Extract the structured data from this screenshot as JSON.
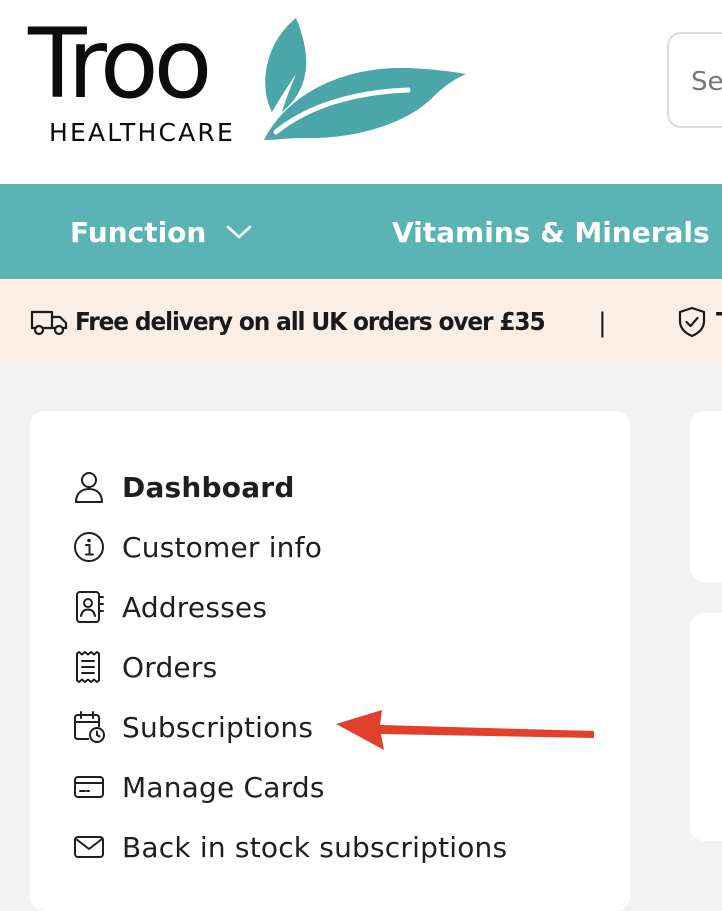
{
  "header": {
    "brand_name": "Troo",
    "brand_sub": "HEALTHCARE",
    "search": {
      "placeholder": "Search",
      "value": ""
    }
  },
  "nav": {
    "items": [
      {
        "label": "Function"
      },
      {
        "label": "Vitamins & Minerals"
      }
    ]
  },
  "announcement": {
    "delivery": "Free delivery on all UK orders over £35",
    "separator": "|",
    "next_item_fragment": "T"
  },
  "account_menu": {
    "items": [
      {
        "label": "Dashboard",
        "icon": "user-icon",
        "active": true
      },
      {
        "label": "Customer info",
        "icon": "info-icon"
      },
      {
        "label": "Addresses",
        "icon": "address-book-icon"
      },
      {
        "label": "Orders",
        "icon": "receipt-icon"
      },
      {
        "label": "Subscriptions",
        "icon": "calendar-clock-icon"
      },
      {
        "label": "Manage Cards",
        "icon": "credit-card-icon"
      },
      {
        "label": "Back in stock subscriptions",
        "icon": "envelope-icon"
      }
    ]
  },
  "colors": {
    "brand_teal": "#5ab4b4",
    "logo_teal": "#4aa6a8",
    "announcement_bg": "#fbeee4",
    "page_bg": "#f2f2f2",
    "annotation_arrow": "#e3402b"
  }
}
